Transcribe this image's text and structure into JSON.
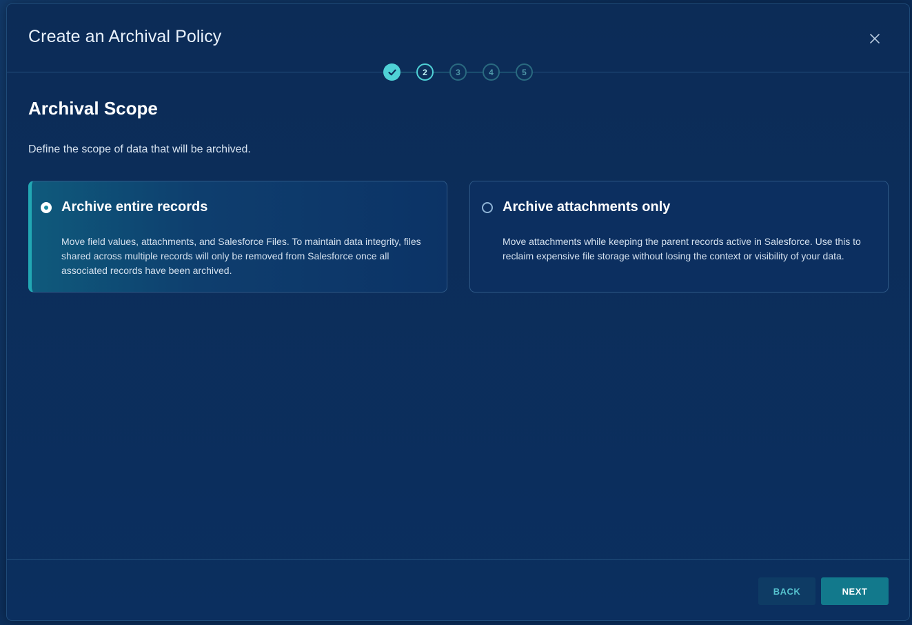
{
  "modal": {
    "title": "Create an Archival Policy",
    "close_icon": "close-icon"
  },
  "stepper": {
    "steps": [
      {
        "label": "",
        "state": "completed",
        "icon": "check-icon"
      },
      {
        "label": "2",
        "state": "current"
      },
      {
        "label": "3",
        "state": "upcoming"
      },
      {
        "label": "4",
        "state": "upcoming"
      },
      {
        "label": "5",
        "state": "upcoming"
      }
    ]
  },
  "section": {
    "title": "Archival Scope",
    "description": "Define the scope of data that will be archived."
  },
  "options": [
    {
      "title": "Archive entire records",
      "description": "Move field values, attachments, and Salesforce Files. To maintain data integrity, files shared across multiple records will only be removed from Salesforce once all associated records have been archived.",
      "selected": true
    },
    {
      "title": "Archive attachments only",
      "description": "Move attachments while keeping the parent records active in Salesforce. Use this to reclaim expensive file storage without losing the context or visibility of your data.",
      "selected": false
    }
  ],
  "footer": {
    "back_label": "BACK",
    "next_label": "NEXT"
  },
  "colors": {
    "accent": "#4fd1d6",
    "primary_button": "#12798c",
    "background": "#0b2f5f"
  }
}
